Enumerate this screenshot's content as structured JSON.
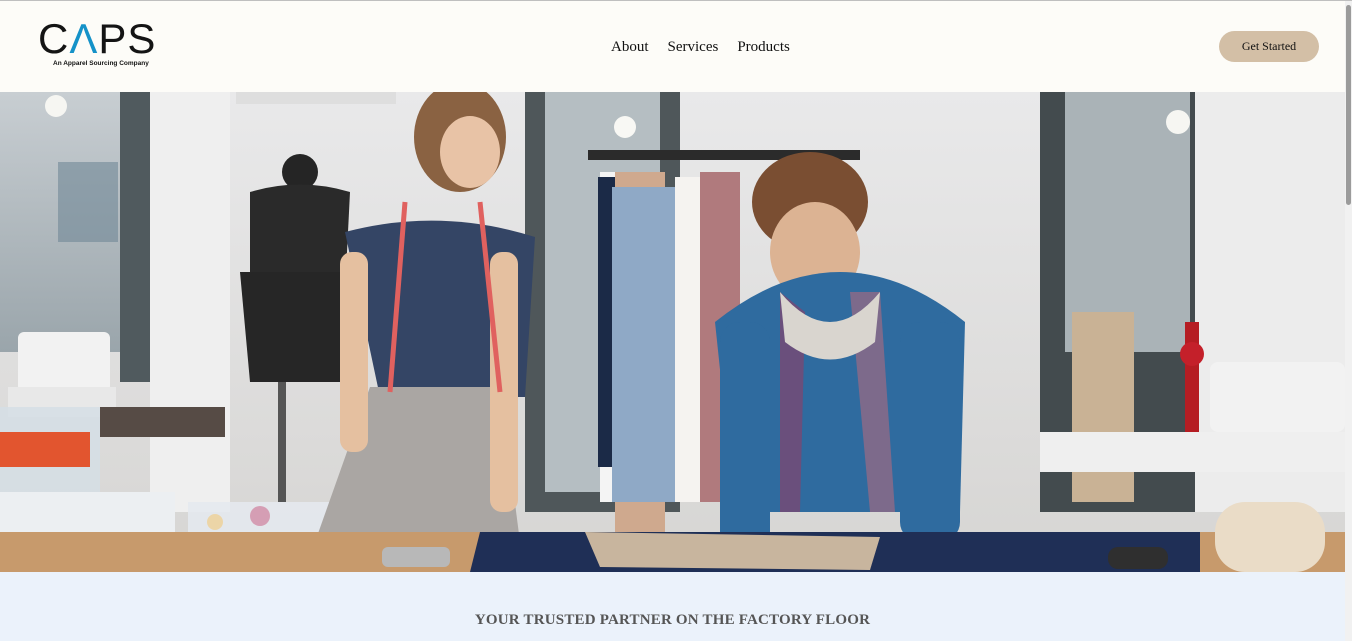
{
  "header": {
    "logo_text_1": "C",
    "logo_text_2": "Λ",
    "logo_text_3": "PS",
    "logo_tagline": "An Apparel Sourcing Company",
    "nav": [
      {
        "label": "About"
      },
      {
        "label": "Services"
      },
      {
        "label": "Products"
      }
    ],
    "cta_label": "Get Started"
  },
  "hero": {
    "image_subject": "fashion-designers-workshop"
  },
  "band": {
    "title": "YOUR TRUSTED PARTNER ON THE FACTORY FLOOR"
  },
  "colors": {
    "header_bg": "#fdfcf8",
    "cta_bg": "#d3bfa6",
    "logo_accent": "#1592c8",
    "band_bg": "#ebf2fb"
  }
}
